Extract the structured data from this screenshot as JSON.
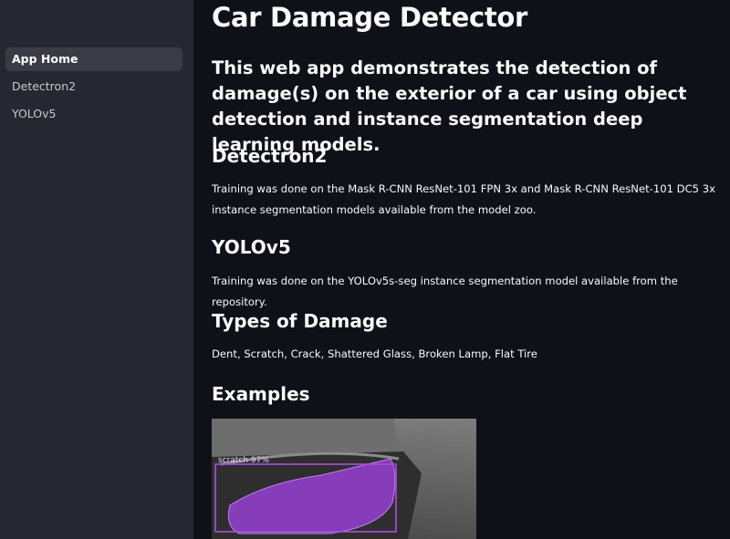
{
  "sidebar": {
    "items": [
      {
        "label": "App Home",
        "active": true
      },
      {
        "label": "Detectron2",
        "active": false
      },
      {
        "label": "YOLOv5",
        "active": false
      }
    ]
  },
  "main": {
    "title": "Car Damage Detector",
    "intro": "This web app demonstrates the detection of damage(s) on the exterior of a car using object detection and instance segmentation deep learning models.",
    "sections": [
      {
        "heading": "Detectron2",
        "text": "Training was done on the Mask R-CNN ResNet-101 FPN 3x and Mask R-CNN ResNet-101 DC5 3x instance segmentation models available from the model zoo."
      },
      {
        "heading": "YOLOv5",
        "text": "Training was done on the YOLOv5s-seg instance segmentation model available from the repository."
      },
      {
        "heading": "Types of Damage",
        "text": "Dent, Scratch, Crack, Shattered Glass, Broken Lamp, Flat Tire"
      },
      {
        "heading": "Examples",
        "text": ""
      }
    ],
    "example": {
      "detection_label": "scratch 97%",
      "mask_color": "#9b3fd9"
    }
  },
  "theme": {
    "background": "#0e1117",
    "sidebar_background": "#262730",
    "active_item_background": "#3a3b45",
    "text": "#fafafa"
  }
}
